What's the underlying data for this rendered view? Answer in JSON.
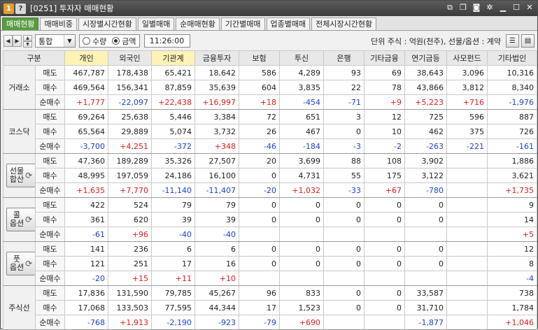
{
  "title": {
    "badge1": "1",
    "badge2": "?",
    "text": "[0251] 투자자 매매현황"
  },
  "tabs": [
    "매매현황",
    "매매비중",
    "시장별시간현황",
    "일별매매",
    "순매매현황",
    "기간별매매",
    "업종별매매",
    "전체시장시간현황"
  ],
  "toolbar": {
    "market_select": "통합",
    "radio_qty": "수량",
    "radio_amount": "금액",
    "time": "11:26:00",
    "unit_text": "단위 주식 : 억원(천주), 선물/옵션 : 계약"
  },
  "columns": [
    "구분",
    "개인",
    "외국인",
    "기관계",
    "금융투자",
    "보험",
    "투신",
    "은행",
    "기타금융",
    "연기금등",
    "사모펀드",
    "기타법인"
  ],
  "groups": [
    {
      "name": "거래소",
      "button": false,
      "rows": [
        {
          "label": "매도",
          "values": [
            "467,787",
            "178,438",
            "65,421",
            "18,642",
            "586",
            "4,289",
            "93",
            "69",
            "38,643",
            "3,096",
            "10,316"
          ]
        },
        {
          "label": "매수",
          "values": [
            "469,564",
            "156,341",
            "87,859",
            "35,639",
            "604",
            "3,835",
            "22",
            "78",
            "43,866",
            "3,812",
            "8,340"
          ]
        },
        {
          "label": "순매수",
          "values": [
            "+1,777",
            "-22,097",
            "+22,438",
            "+16,997",
            "+18",
            "-454",
            "-71",
            "+9",
            "+5,223",
            "+716",
            "-1,976"
          ]
        }
      ]
    },
    {
      "name": "코스닥",
      "button": false,
      "rows": [
        {
          "label": "매도",
          "values": [
            "69,264",
            "25,638",
            "5,446",
            "3,384",
            "72",
            "651",
            "3",
            "12",
            "725",
            "596",
            "887"
          ]
        },
        {
          "label": "매수",
          "values": [
            "65,564",
            "29,889",
            "5,074",
            "3,732",
            "26",
            "467",
            "0",
            "10",
            "462",
            "375",
            "726"
          ]
        },
        {
          "label": "순매수",
          "values": [
            "-3,700",
            "+4,251",
            "-372",
            "+348",
            "-46",
            "-184",
            "-3",
            "-2",
            "-263",
            "-221",
            "-161"
          ]
        }
      ]
    },
    {
      "name": "선물합산",
      "label_lines": [
        "선물",
        "합산"
      ],
      "button": true,
      "rows": [
        {
          "label": "매도",
          "values": [
            "47,360",
            "189,289",
            "35,326",
            "27,507",
            "20",
            "3,699",
            "88",
            "108",
            "3,902",
            "",
            "1,886"
          ]
        },
        {
          "label": "매수",
          "values": [
            "48,995",
            "197,059",
            "24,186",
            "16,100",
            "0",
            "4,731",
            "55",
            "175",
            "3,122",
            "",
            "3,621"
          ]
        },
        {
          "label": "순매수",
          "values": [
            "+1,635",
            "+7,770",
            "-11,140",
            "-11,407",
            "-20",
            "+1,032",
            "-33",
            "+67",
            "-780",
            "",
            "+1,735"
          ]
        }
      ]
    },
    {
      "name": "콜옵션",
      "label_lines": [
        "콜",
        "옵션"
      ],
      "button": true,
      "rows": [
        {
          "label": "매도",
          "values": [
            "422",
            "524",
            "79",
            "79",
            "0",
            "0",
            "0",
            "0",
            "0",
            "",
            "9"
          ]
        },
        {
          "label": "매수",
          "values": [
            "361",
            "620",
            "39",
            "39",
            "0",
            "0",
            "0",
            "0",
            "0",
            "",
            "14"
          ]
        },
        {
          "label": "순매수",
          "values": [
            "-61",
            "+96",
            "-40",
            "-40",
            "",
            "",
            "",
            "",
            "",
            "",
            "+5"
          ]
        }
      ]
    },
    {
      "name": "풋옵션",
      "label_lines": [
        "풋",
        "옵션"
      ],
      "button": true,
      "rows": [
        {
          "label": "매도",
          "values": [
            "141",
            "236",
            "6",
            "6",
            "0",
            "0",
            "0",
            "0",
            "0",
            "",
            "12"
          ]
        },
        {
          "label": "매수",
          "values": [
            "121",
            "251",
            "17",
            "16",
            "0",
            "0",
            "0",
            "0",
            "0",
            "",
            "8"
          ]
        },
        {
          "label": "순매수",
          "values": [
            "-20",
            "+15",
            "+11",
            "+10",
            "",
            "",
            "",
            "",
            "",
            "",
            "-4"
          ]
        }
      ]
    },
    {
      "name": "주식선",
      "button": false,
      "rows": [
        {
          "label": "매도",
          "values": [
            "17,836",
            "131,590",
            "79,785",
            "45,267",
            "96",
            "833",
            "0",
            "0",
            "33,587",
            "",
            "738"
          ]
        },
        {
          "label": "매수",
          "values": [
            "17,068",
            "133,503",
            "77,595",
            "44,344",
            "17",
            "1,523",
            "0",
            "0",
            "31,710",
            "",
            "1,784"
          ]
        },
        {
          "label": "순매수",
          "values": [
            "-768",
            "+1,913",
            "-2,190",
            "-923",
            "-79",
            "+690",
            "",
            "",
            "-1,877",
            "",
            "+1,046"
          ]
        }
      ]
    }
  ],
  "colors": {
    "active_tab": "#5a9b41",
    "positive": "#e11b1b",
    "negative": "#1d3fcf",
    "highlight_header": "#fdf3b6"
  }
}
